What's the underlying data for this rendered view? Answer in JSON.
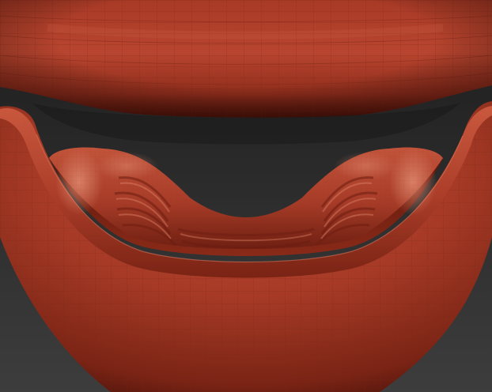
{
  "viewport": {
    "background_top": "#1e1e1e",
    "background_bottom": "#3c3c3c"
  },
  "model": {
    "surface_color": "#b4432e",
    "surface_highlight": "#d46a50",
    "surface_shadow": "#5a170d",
    "wire_color": "#8e2f1f"
  }
}
